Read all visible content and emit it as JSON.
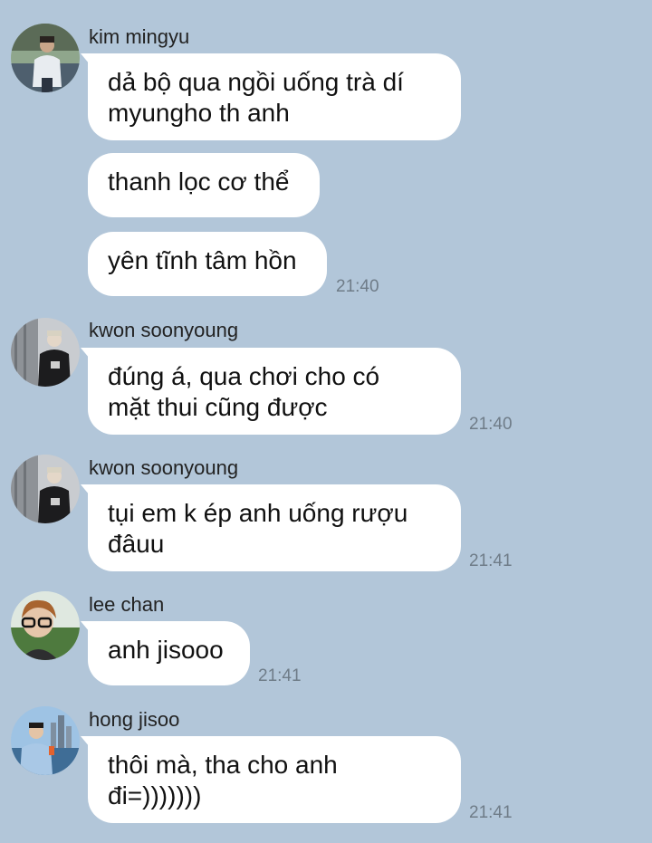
{
  "messages": {
    "group1": {
      "sender": "kim mingyu",
      "bubble1": "dả bộ qua ngồi uống trà dí\nmyungho th anh",
      "bubble2": "thanh lọc cơ thể",
      "bubble3": "yên tĩnh tâm hồn",
      "time": "21:40"
    },
    "group2": {
      "sender": "kwon soonyoung",
      "bubble1": "đúng á, qua chơi cho có\nmặt thui cũng được",
      "time": "21:40"
    },
    "group3": {
      "sender": "kwon soonyoung",
      "bubble1": "tụi em k ép anh uống rượu\nđâuu",
      "time": "21:41"
    },
    "group4": {
      "sender": "lee chan",
      "bubble1": "anh jisooo",
      "time": "21:41"
    },
    "group5": {
      "sender": "hong jisoo",
      "bubble1": "thôi mà, tha cho anh\nđi=)))))))",
      "time": "21:41"
    }
  },
  "colors": {
    "background": "#b2c6d9",
    "bubble": "#ffffff",
    "timestamp": "#6f7c88"
  }
}
